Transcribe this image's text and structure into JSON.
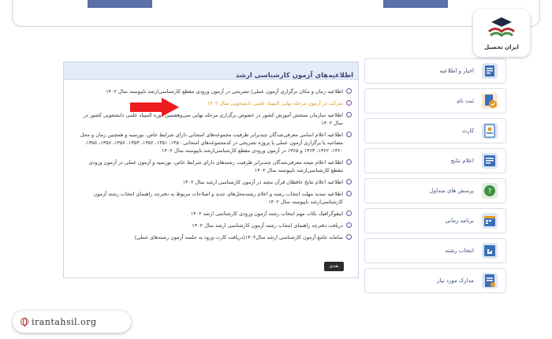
{
  "news": {
    "title": "اطلاعیه‌های آزمون کارشناسی ارشد",
    "more_label": "بعدی",
    "items": [
      {
        "text": "اطلاعیه زمان و مکان برگزاری آزمون عملی/ تشریحی در آزمون ورودی مقطع کارشناسی‌ارشد ناپیوسته سال ۱۴۰۲",
        "highlight": false
      },
      {
        "text": "شرکت در آزمون مرحله نهایی المپیاد علمی دانشجویی سال ۱۴۰۲",
        "highlight": true
      },
      {
        "text": "اطلاعیه سازمان سنجش آموزش کشور در خصوص برگزاری مرحله نهایی سی‌وهفتمین دوره المپیاد علمی دانشجویی کشور در سال ۱۴۰۲",
        "highlight": false
      },
      {
        "text": "اطلاعیه اعلام اسامی معرفی‌شدگان چندبرابر ظرفیت مجموعه‌های امتحانی دارای شرایط خاص، بورسیه و همچنین زمان و محل مصاحبه یا برگزاری آزمون عملی یا پروژه تشریحی در کدمجموعه‌های امتحانی ۱۳۵۰، ۱۳۵۱، ۱۳۵۲، ۱۳۵۳، ۱۳۵۶، ۱۳۵۷، ۱۳۵۸، ۱۳۶۰، ۱۳۶۲، ۱۳۶۳ و ۱۳۶۵ در آزمون ورودی مقطع کارشناسی‌ارشد ناپیوسته سال ۱۴۰۲",
        "highlight": false
      },
      {
        "text": "اطلاعیه اعلام نتیجه معرفی‌شدگان چندبرابر ظرفیت رشته‌های دارای شرایط خاص، بورسیه و آزمون عملی در آزمون ورودی مقطع کارشناسی‌ارشد ناپیوسته سال ۱۴۰۲",
        "highlight": false
      },
      {
        "text": "اطلاعیه اعلام نتایج حافظان قرآن مجید در آزمون کارشناسی ارشد سال ۱۴۰۲",
        "highlight": false
      },
      {
        "text": "اطلاعیه تمدید مهلت انتخاب رشته و اعلام رشته‌محل‌های جدید و اصلاحات مربوط به دفترچه راهنمای انتخاب رشته آزمون کارشناسی‌ارشد ناپیوسته سال ۱۴۰۲",
        "highlight": false
      },
      {
        "text": "اینفوگرافیک نکات مهم انتخاب رشته آزمون ورودی کارشناسی ارشد ۱۴۰۲",
        "highlight": false
      },
      {
        "text": "دریافت دفترچه راهنمای انتخاب رشته آزمون کارشناسی ارشد سال ۱۴۰۲",
        "highlight": false
      },
      {
        "text": "سامانه جامع آزمون کارشناسی ارشد سال۱۴۰۲(دریافت کارت ورود به جلسه آزمون رشته‌های عملی)",
        "highlight": false
      }
    ]
  },
  "sidebar": {
    "items": [
      {
        "label": "اخبار و اطلاعیه",
        "icon": "news-icon",
        "color": "#3b6fb6"
      },
      {
        "label": "ثبت نام",
        "icon": "register-icon",
        "color": "#e39b2a"
      },
      {
        "label": "کارت",
        "icon": "card-icon",
        "color": "#3b6fb6"
      },
      {
        "label": "اعلام نتایج",
        "icon": "results-icon",
        "color": "#3b6fb6"
      },
      {
        "label": "پرسش های متداول",
        "icon": "faq-icon",
        "color": "#3f8f3f"
      },
      {
        "label": "برنامه زمانی",
        "icon": "calendar-icon",
        "color": "#3b6fb6"
      },
      {
        "label": "انتخاب رشته",
        "icon": "selection-icon",
        "color": "#3b6fb6"
      },
      {
        "label": "مدارک مورد نیاز",
        "icon": "documents-icon",
        "color": "#3b6fb6"
      }
    ]
  },
  "logo": {
    "text": "ایران تحصیل"
  },
  "site": {
    "url": "irantahsil.org"
  }
}
